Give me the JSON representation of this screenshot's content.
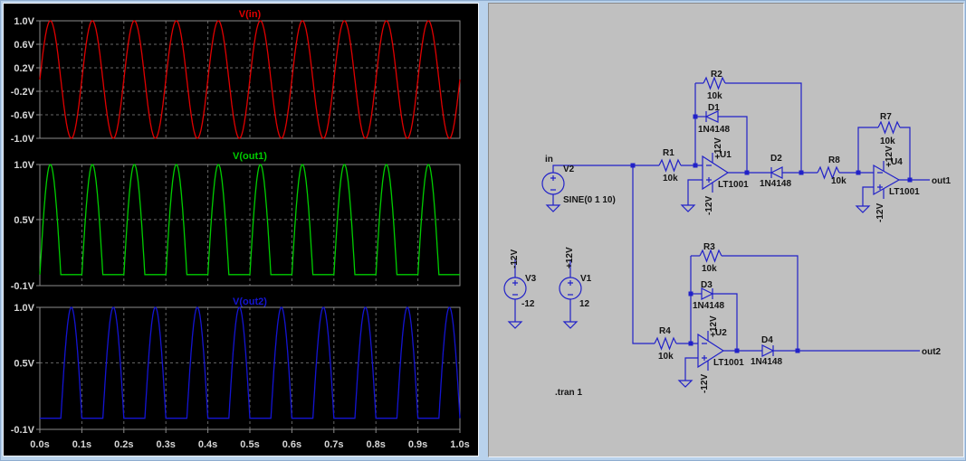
{
  "window": {
    "bg_color": "#b9d2ec",
    "wave_pane_bg": "#000000",
    "schematic_bg": "#c0c0c0"
  },
  "chart_data": {
    "type": "line",
    "title": "",
    "x": {
      "min": 0,
      "max": 1,
      "unit": "s",
      "ticks": [
        {
          "v": 0.0,
          "label": "0.0s"
        },
        {
          "v": 0.1,
          "label": "0.1s"
        },
        {
          "v": 0.2,
          "label": "0.2s"
        },
        {
          "v": 0.3,
          "label": "0.3s"
        },
        {
          "v": 0.4,
          "label": "0.4s"
        },
        {
          "v": 0.5,
          "label": "0.5s"
        },
        {
          "v": 0.6,
          "label": "0.6s"
        },
        {
          "v": 0.7,
          "label": "0.7s"
        },
        {
          "v": 0.8,
          "label": "0.8s"
        },
        {
          "v": 0.9,
          "label": "0.9s"
        },
        {
          "v": 1.0,
          "label": "1.0s"
        }
      ]
    },
    "signal_params": {
      "amplitude_v": 1,
      "frequency_hz": 10
    },
    "grid": true,
    "legend_position": "top-center-per-panel",
    "frame_color": "#8c8c8c",
    "grid_color": "#686868",
    "label_color": "#d6d6d6",
    "panels": [
      {
        "title": "V(in)",
        "color": "#e00000",
        "signal": "sine",
        "ylim": [
          -1.0,
          1.0
        ],
        "yticks": [
          {
            "v": 1.0,
            "label": "1.0V"
          },
          {
            "v": 0.6,
            "label": "0.6V"
          },
          {
            "v": 0.2,
            "label": "0.2V"
          },
          {
            "v": -0.2,
            "label": "-0.2V"
          },
          {
            "v": -0.6,
            "label": "-0.6V"
          },
          {
            "v": -1.0,
            "label": "-1.0V"
          }
        ]
      },
      {
        "title": "V(out1)",
        "color": "#00cd00",
        "signal": "positive-half",
        "ylim": [
          -0.1,
          1.0
        ],
        "yticks": [
          {
            "v": 1.0,
            "label": "1.0V"
          },
          {
            "v": 0.5,
            "label": "0.5V"
          },
          {
            "v": -0.1,
            "label": "-0.1V"
          }
        ]
      },
      {
        "title": "V(out2)",
        "color": "#1414d2",
        "signal": "negative-half-inverted",
        "ylim": [
          -0.1,
          1.0
        ],
        "yticks": [
          {
            "v": 1.0,
            "label": "1.0V"
          },
          {
            "v": 0.5,
            "label": "0.5V"
          },
          {
            "v": -0.1,
            "label": "-0.1V"
          }
        ]
      }
    ]
  },
  "schematic": {
    "wire_color": "#2121c8",
    "text_color": "#141414",
    "net_labels": {
      "in": "in",
      "out1": "out1",
      "out2": "out2"
    },
    "directive": ".tran 1",
    "components": {
      "V2": {
        "name": "V2",
        "value": "SINE(0 1 10)"
      },
      "V3": {
        "name": "V3",
        "value": "-12",
        "rail": "-12V"
      },
      "V1": {
        "name": "V1",
        "value": "12",
        "rail": "+12V"
      },
      "R1": {
        "name": "R1",
        "value": "10k"
      },
      "R2": {
        "name": "R2",
        "value": "10k"
      },
      "R3": {
        "name": "R3",
        "value": "10k"
      },
      "R4": {
        "name": "R4",
        "value": "10k"
      },
      "R7": {
        "name": "R7",
        "value": "10k"
      },
      "R8": {
        "name": "R8",
        "value": "10k"
      },
      "D1": {
        "name": "D1",
        "value": "1N4148"
      },
      "D2": {
        "name": "D2",
        "value": "1N4148"
      },
      "D3": {
        "name": "D3",
        "value": "1N4148"
      },
      "D4": {
        "name": "D4",
        "value": "1N4148"
      },
      "U1": {
        "name": "U1",
        "part": "LT1001",
        "vplus": "+12V",
        "vminus": "-12V"
      },
      "U2": {
        "name": "U2",
        "part": "LT1001",
        "vplus": "+12V",
        "vminus": "-12V"
      },
      "U4": {
        "name": "U4",
        "part": "LT1001",
        "vplus": "+12V",
        "vminus": "-12V"
      }
    }
  }
}
